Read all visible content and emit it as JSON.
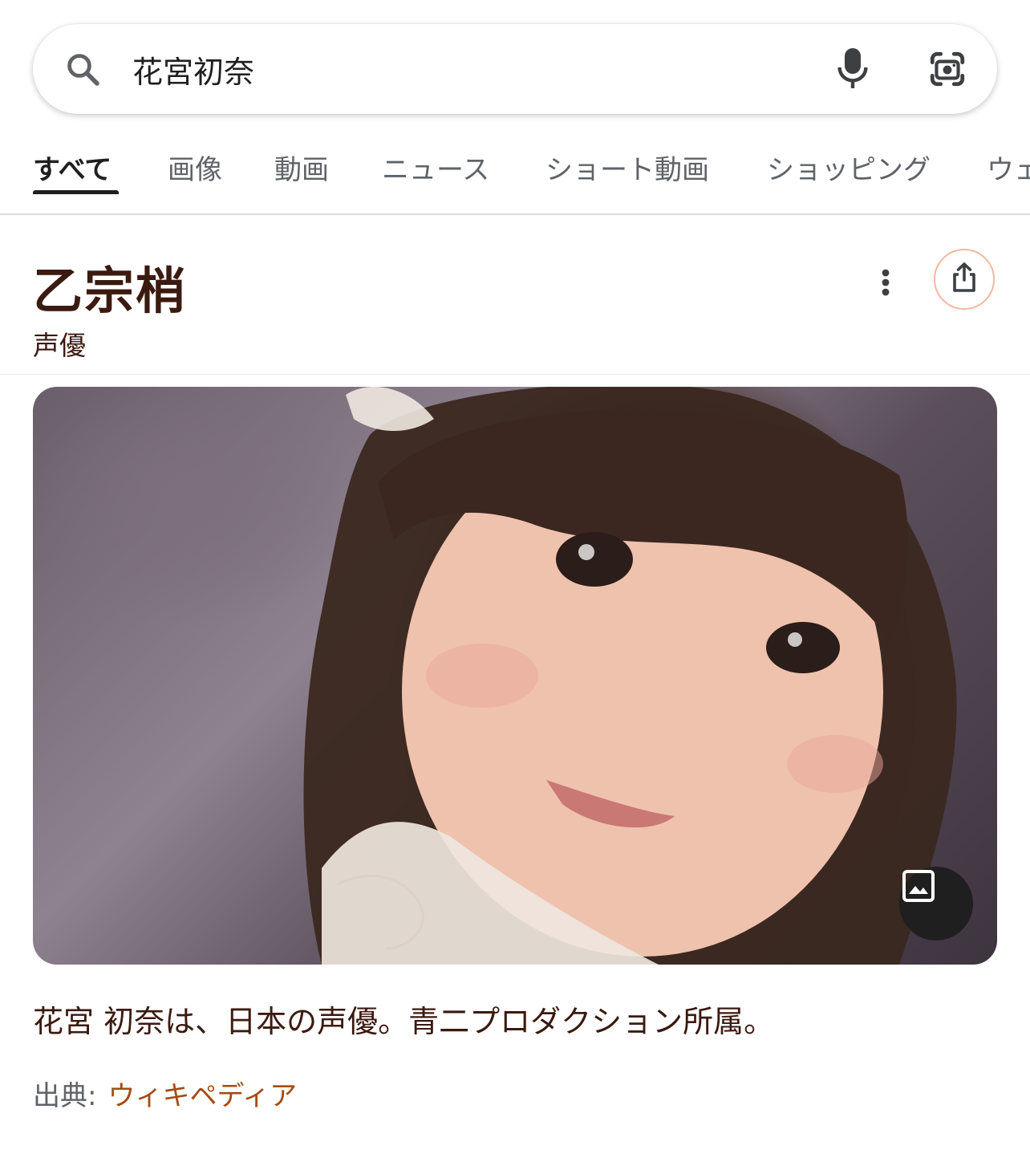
{
  "search": {
    "query": "花宮初奈"
  },
  "tabs": [
    {
      "label": "すべて",
      "active": true
    },
    {
      "label": "画像"
    },
    {
      "label": "動画"
    },
    {
      "label": "ニュース"
    },
    {
      "label": "ショート動画"
    },
    {
      "label": "ショッピング"
    },
    {
      "label": "ウェ"
    }
  ],
  "knowledge_panel": {
    "title": "乙宗梢",
    "subtitle": "声優",
    "description": "花宮 初奈は、日本の声優。青二プロダクション所属。",
    "source_label": "出典:",
    "source_link": "ウィキペディア"
  },
  "icons": {
    "search": "search-icon",
    "mic": "microphone-icon",
    "lens": "camera-lens-icon",
    "more": "more-vertical-icon",
    "share": "share-icon",
    "gallery": "image-gallery-icon"
  },
  "colors": {
    "title": "#3b1a10",
    "link": "#a64b12",
    "share_border": "#f2b8a0"
  }
}
